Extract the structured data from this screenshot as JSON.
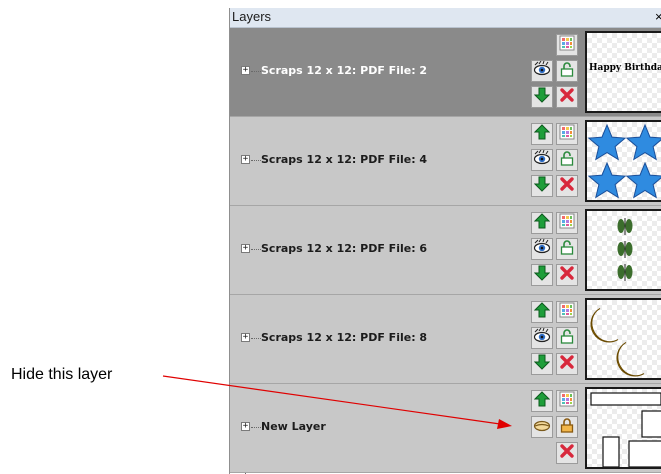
{
  "panel": {
    "title": "Layers",
    "close_glyph": "×"
  },
  "layers": [
    {
      "name": "Scraps 12 x 12: PDF File: 2",
      "selected": true,
      "visible": true,
      "thumbnail": "happy-birthday-text",
      "thumbnail_text": "Happy Birthday"
    },
    {
      "name": "Scraps 12 x 12: PDF File: 4",
      "selected": false,
      "visible": true,
      "thumbnail": "blue-stars"
    },
    {
      "name": "Scraps 12 x 12: PDF File: 6",
      "selected": false,
      "visible": true,
      "thumbnail": "green-leaves"
    },
    {
      "name": "Scraps 12 x 12: PDF File: 8",
      "selected": false,
      "visible": true,
      "thumbnail": "yellow-moons"
    },
    {
      "name": "New Layer",
      "selected": false,
      "visible": false,
      "thumbnail": "rectangles"
    }
  ],
  "expander_glyph": "+",
  "annotation": {
    "text": "Hide this layer",
    "arrow_color": "#e00000"
  },
  "colors": {
    "arrow_green": "#1e9e3a",
    "delete_red": "#d8283c",
    "star_blue": "#2f8be0",
    "moon_yellow": "#f5c21b",
    "leaf_green": "#3b6d2c"
  }
}
